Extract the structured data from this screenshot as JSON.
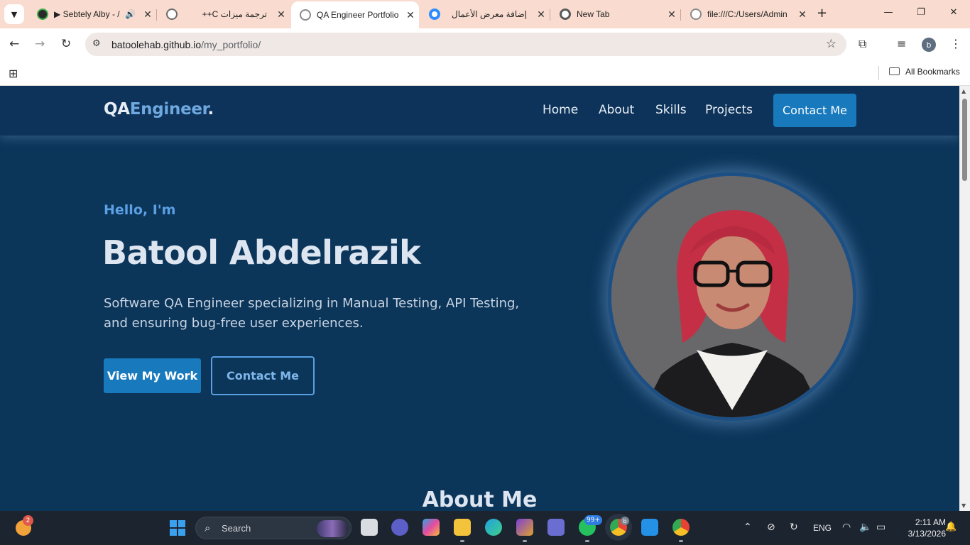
{
  "browser": {
    "tabs": [
      {
        "title": "▶ Sebtely Alby - /",
        "audio": "🔊",
        "favicon_color": "#2b2b2b",
        "active": false
      },
      {
        "title": "ترجمة ميزات C++",
        "favicon_color": "#6b6b6b",
        "active": false
      },
      {
        "title": "QA Engineer Portfolio",
        "favicon_color": "#8a8a8a",
        "active": true
      },
      {
        "title": "إضافة معرض الأعمال",
        "favicon_color": "#2d8cff",
        "active": false
      },
      {
        "title": "New Tab",
        "favicon_color": "#5a5a5a",
        "active": false
      },
      {
        "title": "file:///C:/Users/Admin",
        "favicon_color": "#8a8a8a",
        "active": false
      }
    ],
    "url_host": "batoolehab.github.io",
    "url_path": "/my_portfolio/",
    "profile_initial": "b",
    "all_bookmarks": "All Bookmarks"
  },
  "site": {
    "logo_main": "QA",
    "logo_accent": "Engineer",
    "logo_dot": ".",
    "nav": {
      "home": "Home",
      "about": "About",
      "skills": "Skills",
      "projects": "Projects",
      "contact": "Contact Me"
    },
    "hero": {
      "greeting": "Hello, I'm",
      "name": "Batool Abdelrazik",
      "description": "Software QA Engineer specializing in Manual Testing, API Testing, and ensuring bug-free user experiences.",
      "primary_button": "View My Work",
      "secondary_button": "Contact Me"
    },
    "about_title": "About Me",
    "colors": {
      "background": "#0c355a",
      "accent": "#1879bd",
      "highlight": "#5aa0e3"
    }
  },
  "taskbar": {
    "widget_badge": "2",
    "search_label": "Search",
    "whatsapp_badge": "99+",
    "chrome_profile_badge": "b",
    "language": "ENG",
    "time": "2:11 AM",
    "date": "3/13/2026"
  }
}
